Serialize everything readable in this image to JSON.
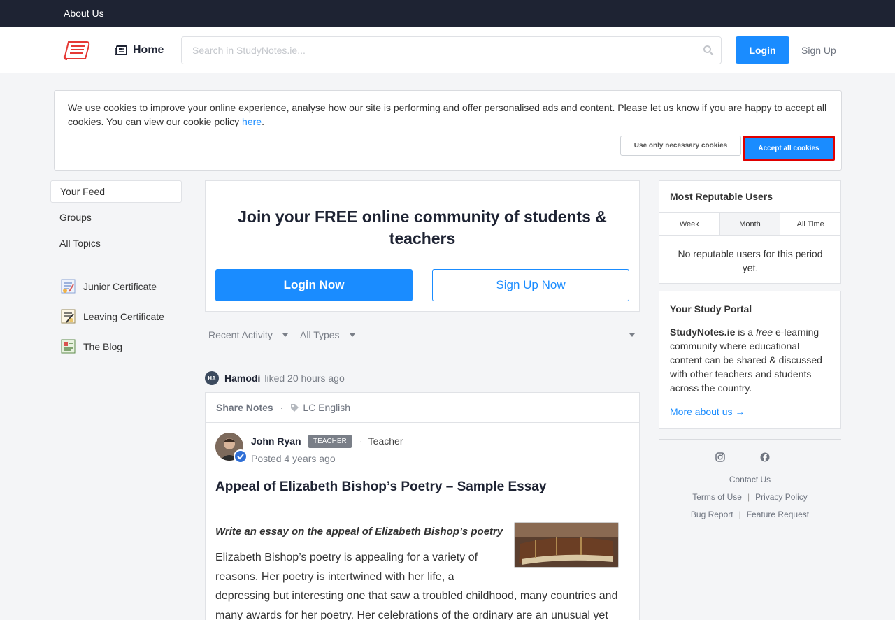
{
  "topbar": {
    "about": "About Us"
  },
  "header": {
    "home": "Home",
    "search_placeholder": "Search in StudyNotes.ie...",
    "login": "Login",
    "signup": "Sign Up"
  },
  "cookie": {
    "text": "We use cookies to improve your online experience, analyse how our site is performing and offer personalised ads and content. Please let us know if you are happy to accept all cookies. You can view our cookie policy ",
    "link": "here",
    "end": ".",
    "necessary": "Use only necessary cookies",
    "accept": "Accept all cookies"
  },
  "leftnav": {
    "items": [
      "Your Feed",
      "Groups",
      "All Topics"
    ],
    "topics": [
      "Junior Certificate",
      "Leaving Certificate",
      "The Blog"
    ]
  },
  "join": {
    "title": "Join your FREE online community of students & teachers",
    "login_now": "Login Now",
    "signup_now": "Sign Up Now"
  },
  "filters": {
    "sort": "Recent Activity",
    "types": "All Types"
  },
  "activity": {
    "initials": "HA",
    "user": "Hamodi",
    "action": "liked 20 hours ago"
  },
  "post": {
    "group": "Share Notes",
    "tag": "LC English",
    "author": "John Ryan",
    "badge": "TEACHER",
    "role": "Teacher",
    "posted": "Posted 4 years ago",
    "title": "Appeal of Elizabeth Bishop’s Poetry – Sample Essay",
    "question": "Write an essay on the appeal of Elizabeth Bishop’s poetry",
    "body": [
      "Elizabeth Bishop’s poetry is appealing for a variety of",
      "reasons. Her poetry is intertwined with her life, a",
      "depressing but interesting one that saw a troubled childhood, many countries and",
      "many awards for her poetry. Her celebrations of the ordinary are an unusual yet"
    ]
  },
  "reputable": {
    "title": "Most Reputable Users",
    "tabs": [
      "Week",
      "Month",
      "All Time"
    ],
    "active_tab": "Month",
    "empty": "No reputable users for this period yet."
  },
  "portal": {
    "title": "Your Study Portal",
    "site": "StudyNotes.ie",
    "text1": " is a ",
    "free": "free",
    "text2": " e-learning community where educational content can be shared & discussed with other teachers and students across the country.",
    "more": "More about us →"
  },
  "footer": {
    "contact": "Contact Us",
    "terms": "Terms of Use",
    "privacy": "Privacy Policy",
    "bug": "Bug Report",
    "feature": "Feature Request",
    "separator": "|"
  },
  "colors": {
    "accent": "#1a8cff",
    "dark": "#1e2333",
    "highlight": "#e00000"
  }
}
